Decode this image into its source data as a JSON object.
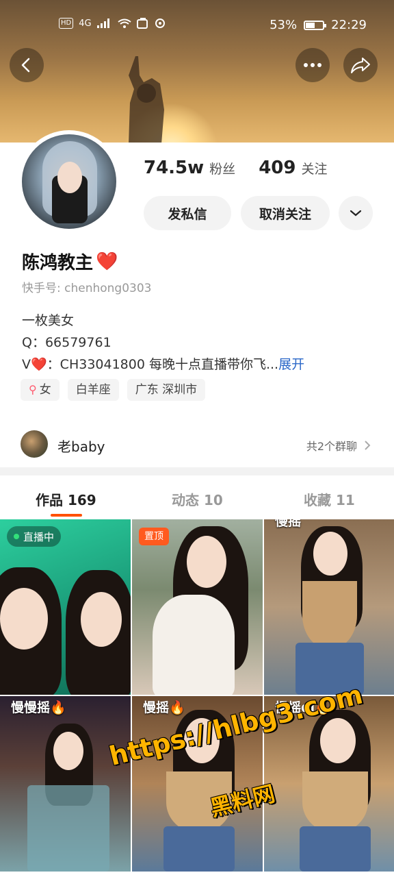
{
  "status_bar": {
    "hd": "HD",
    "network": "4G",
    "battery_percent": "53%",
    "battery_level": 0.53,
    "time": "22:29"
  },
  "header": {
    "back_icon": "chevron-left-icon",
    "more_icon": "ellipsis-icon",
    "share_icon": "share-icon"
  },
  "profile": {
    "followers_count": "74.5w",
    "followers_label": "粉丝",
    "following_count": "409",
    "following_label": "关注",
    "message_button": "发私信",
    "unfollow_button": "取消关注",
    "nickname": "陈鸿教主",
    "nickname_heart": "❤️",
    "kuaishou_id": "快手号: chenhong0303",
    "bio_line1": "一枚美女",
    "bio_line2": "Q：66579761",
    "bio_line3_prefix": "V",
    "bio_line3_heart": "❤️",
    "bio_line3_text": "：CH33041800 每晚十点直播带你飞...",
    "bio_expand": "展开",
    "tags": [
      {
        "label": "女",
        "icon": "female-icon"
      },
      {
        "label": "白羊座"
      },
      {
        "label": "广东 深圳市"
      }
    ],
    "group_name": "老baby",
    "group_count": "共2个群聊"
  },
  "tabs": [
    {
      "label": "作品 169",
      "active": true
    },
    {
      "label": "动态 10",
      "active": false
    },
    {
      "label": "收藏 11",
      "active": false
    }
  ],
  "grid": {
    "live_badge": "直播中",
    "pin_badge": "置顶",
    "caption_3": "慢摇",
    "caption_4": "慢慢摇🔥",
    "caption_5": "慢摇🔥",
    "caption_6": "慢摇dj🔥"
  },
  "watermark": {
    "url": "https://hlbg3.com",
    "name": "黑料网"
  },
  "colors": {
    "accent": "#ff5000",
    "link": "#2a67c8",
    "heart": "#e02020",
    "pin": "#ff5a1f",
    "live_dot": "#33e07a"
  }
}
